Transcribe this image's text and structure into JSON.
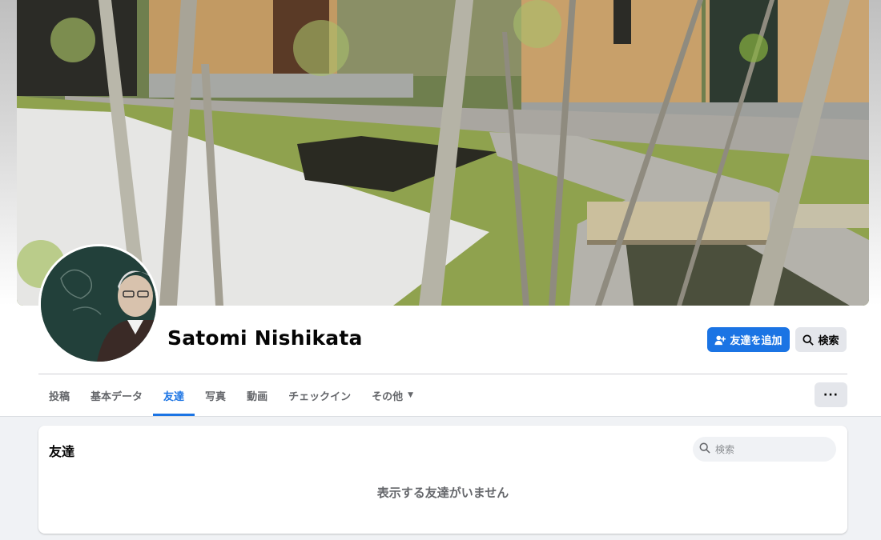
{
  "profile": {
    "name": "Satomi Nishikata"
  },
  "actions": {
    "add_friend_label": "友達を追加",
    "search_label": "検索",
    "more_label": "···"
  },
  "tabs": [
    {
      "label": "投稿"
    },
    {
      "label": "基本データ"
    },
    {
      "label": "友達"
    },
    {
      "label": "写真"
    },
    {
      "label": "動画"
    },
    {
      "label": "チェックイン"
    },
    {
      "label": "その他"
    }
  ],
  "active_tab": "友達",
  "friends_section": {
    "title": "友達",
    "search_placeholder": "検索",
    "empty_message": "表示する友達がいません"
  },
  "colors": {
    "accent": "#1b74e4",
    "secondary_button": "#e4e6eb",
    "page_background": "#f0f2f5",
    "muted_text": "#65676b"
  },
  "icons": {
    "add_friend": "add-friend-icon",
    "search": "search-icon",
    "caret": "caret-down-icon",
    "more": "more-dots-icon"
  }
}
